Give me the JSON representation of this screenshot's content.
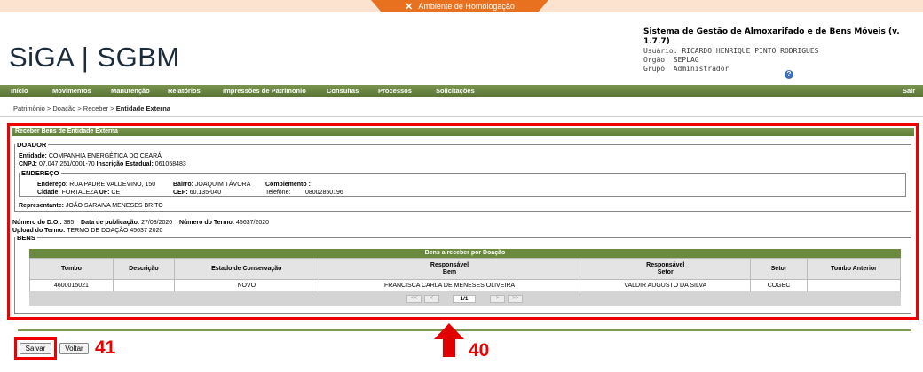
{
  "env_banner": {
    "label": "Ambiente de Homologação",
    "icon": "tools-icon"
  },
  "logo": "SiGA | SGBM",
  "system": {
    "title": "Sistema de Gestão de Almoxarifado e de Bens Móveis (v. 1.7.7)",
    "user": "Usuário: RICARDO HENRIQUE PINTO RODRIGUES",
    "org": "Orgão: SEPLAG",
    "group": "Grupo: Administrador"
  },
  "menu": {
    "items": [
      "Início",
      "Movimentos",
      "Manutenção",
      "Relatórios",
      "Impressões de Patrimonio",
      "Consultas",
      "Processos",
      "Solicitações"
    ],
    "exit": "Sair"
  },
  "breadcrumb": {
    "path": "Patrimônio  > Doação  > Receber > ",
    "current": "Entidade Externa"
  },
  "panel": {
    "title": "Receber Bens de Entidade Externa",
    "donor_legend": "DOADOR",
    "entidade_label": "Entidade:",
    "entidade": "COMPANHIA ENERGÉTICA DO CEARÁ",
    "cnpj_label": "CNPJ:",
    "cnpj": "07.047.251/0001-70",
    "ie_label": "Inscrição Estadual:",
    "ie": "061058483",
    "address_legend": "ENDEREÇO",
    "endereco_label": "Endereço:",
    "endereco": "RUA PADRE VALDEVINO, 150",
    "bairro_label": "Bairro:",
    "bairro": "JOAQUIM TÁVORA",
    "complemento_label": "Complemento :",
    "complemento": "",
    "cidade_label": "Cidade:",
    "cidade": "FORTALEZA",
    "uf_label": "UF:",
    "uf": "CE",
    "cep_label": "CEP:",
    "cep": "60.135-040",
    "telefone_label": "Telefone:",
    "telefone": "08002850196",
    "representante_label": "Representante:",
    "representante": "JOÃO SARAIVA MENESES BRITO",
    "do_label": "Número do D.O.:",
    "do": "385",
    "pub_label": "Data de publicação:",
    "pub": "27/08/2020",
    "termo_label": "Número do Termo:",
    "termo": "45637/2020",
    "upload_label": "Upload do Termo:",
    "upload": "TERMO DE DOAÇÃO 45637 2020",
    "bens_legend": "BENS"
  },
  "grid": {
    "title": "Bens a receber por Doação",
    "headers": [
      "Tombo",
      "Descrição",
      "Estado de Conservação",
      "Responsável\nBem",
      "Responsável\nSetor",
      "Setor",
      "Tombo Anterior"
    ],
    "rows": [
      [
        "4600015021",
        "",
        "NOVO",
        "FRANCISCA CARLA DE MENESES OLIVEIRA",
        "VALDIR AUGUSTO DA SILVA",
        "COGEC",
        ""
      ]
    ],
    "pager": {
      "first": "<<",
      "prev": "<",
      "page": "1/1",
      "next": ">",
      "last": ">>"
    }
  },
  "buttons": {
    "save": "Salvar",
    "back": "Voltar"
  },
  "annotations": {
    "save_num": "41",
    "panel_num": "40",
    "color": "#e00000"
  }
}
